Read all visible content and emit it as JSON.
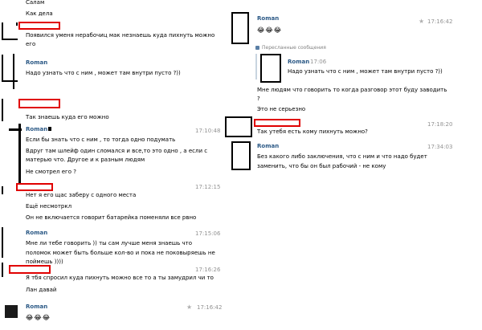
{
  "left": {
    "m0": {
      "text": "Салам"
    },
    "m1": {
      "text": "Как дела"
    },
    "m2": {
      "line1": "Появился уменя нерабочиц мак незнаешь куда пихнуть можно",
      "line2": "его"
    },
    "m3": {
      "name": "Roman",
      "text": "Надо узнать что с ним , может там внутри пусто ?))"
    },
    "m4": {
      "text": "Так знаешь куда его можно"
    },
    "m5": {
      "name": "Roman",
      "time": "17:10:48",
      "l1": "Если бы знать что с ним , то тогда одно подумать",
      "l2": "Вдруг там шлейф один сломался и все,то это одно , а если с",
      "l3": "матерью что. Другое и к разным людям",
      "l4": "Не смотрел его ?"
    },
    "m6": {
      "time": "17:12:15",
      "l1": "Нет я его щас заберу с одного места",
      "l2": "Ещё несмотркл",
      "l3": "Он не включается говорит батарейка поменяли все рвно"
    },
    "m7": {
      "name": "Roman",
      "time": "17:15:06",
      "l1": "Мне ли тебе говорить )) ты сам лучше меня знаешь что",
      "l2": "поломок может быть больше кол-во и пока не поковыряешь не",
      "l3": "поймешь ))))"
    },
    "m8": {
      "time": "17:16:26",
      "l1": "Я тбя спросил куда пихнуть можно все то а ты замудрил чи то",
      "l2": "Лан давай"
    },
    "m9": {
      "name": "Roman",
      "time": "17:16:42",
      "emoji": "😂😂😂"
    }
  },
  "right": {
    "r1": {
      "name": "Roman",
      "time": "17:16:42",
      "emoji": "😂😂😂"
    },
    "fwd": {
      "label": "Пересланные сообщения",
      "name": "Roman",
      "time": "17:06",
      "text": "Надо узнать что с ним , может там внутри пусто ?))"
    },
    "r2": {
      "l1": "Мне людям что говорить то когда разговор этот буду заводить",
      "l2": "?"
    },
    "r3": {
      "text": "Это не серьезно"
    },
    "r4": {
      "time": "17:18:20",
      "text": "Так утебя есть кому пихнуть можно?"
    },
    "r5": {
      "name": "Roman",
      "time": "17:34:03",
      "l1": "Без какого либо заключения, что с ним и что надо будет",
      "l2": "заменить, что бы он был рабочий - не кому"
    }
  },
  "icons": {
    "star": "★",
    "pin": "forward-icon"
  },
  "colors": {
    "name": "#2a5885",
    "time": "#939393",
    "redact": "#e00000"
  }
}
